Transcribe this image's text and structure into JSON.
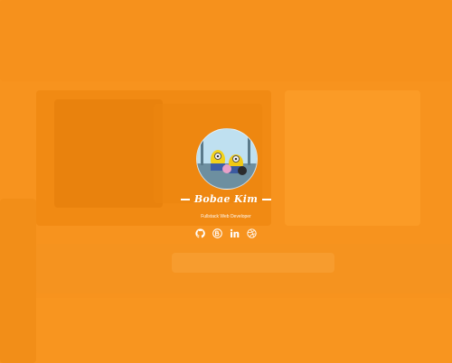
{
  "profile": {
    "name": "Bobae Kim",
    "role": "Fullstack Web Developer"
  },
  "social_links": [
    {
      "icon": "github-icon"
    },
    {
      "icon": "blog-icon"
    },
    {
      "icon": "linkedin-icon"
    },
    {
      "icon": "dribbble-icon"
    }
  ],
  "colors": {
    "background_overlay": "#f7931e",
    "text": "#ffffff"
  }
}
